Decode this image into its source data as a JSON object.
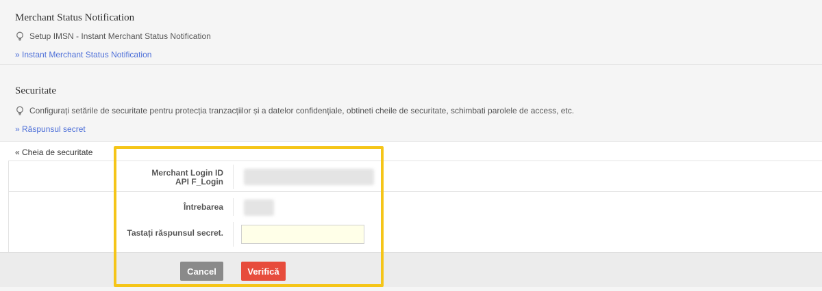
{
  "merchant_status": {
    "title": "Merchant Status Notification",
    "description": "Setup IMSN - Instant Merchant Status Notification",
    "link": "» Instant Merchant Status Notification"
  },
  "security": {
    "title": "Securitate",
    "description": "Configurați setările de securitate pentru protecția tranzacțiilor și a datelor confidențiale, obtineti cheile de securitate, schimbati parolele de access, etc.",
    "link": "» Răspunsul secret"
  },
  "panel": {
    "back_link": "« Cheia de securitate",
    "merchant_login_label": "Merchant Login ID",
    "api_login_label": "API F_Login",
    "question_label": "Întrebarea",
    "answer_label": "Tastați răspunsul secret.",
    "answer_value": "",
    "answer_placeholder": ""
  },
  "buttons": {
    "cancel": "Cancel",
    "verify": "Verifică"
  },
  "colors": {
    "link": "#4d6fd8",
    "verify_button": "#e74c3c",
    "cancel_button": "#8a8a8a",
    "highlight": "#f5c518",
    "input_bg": "#ffffe8"
  }
}
